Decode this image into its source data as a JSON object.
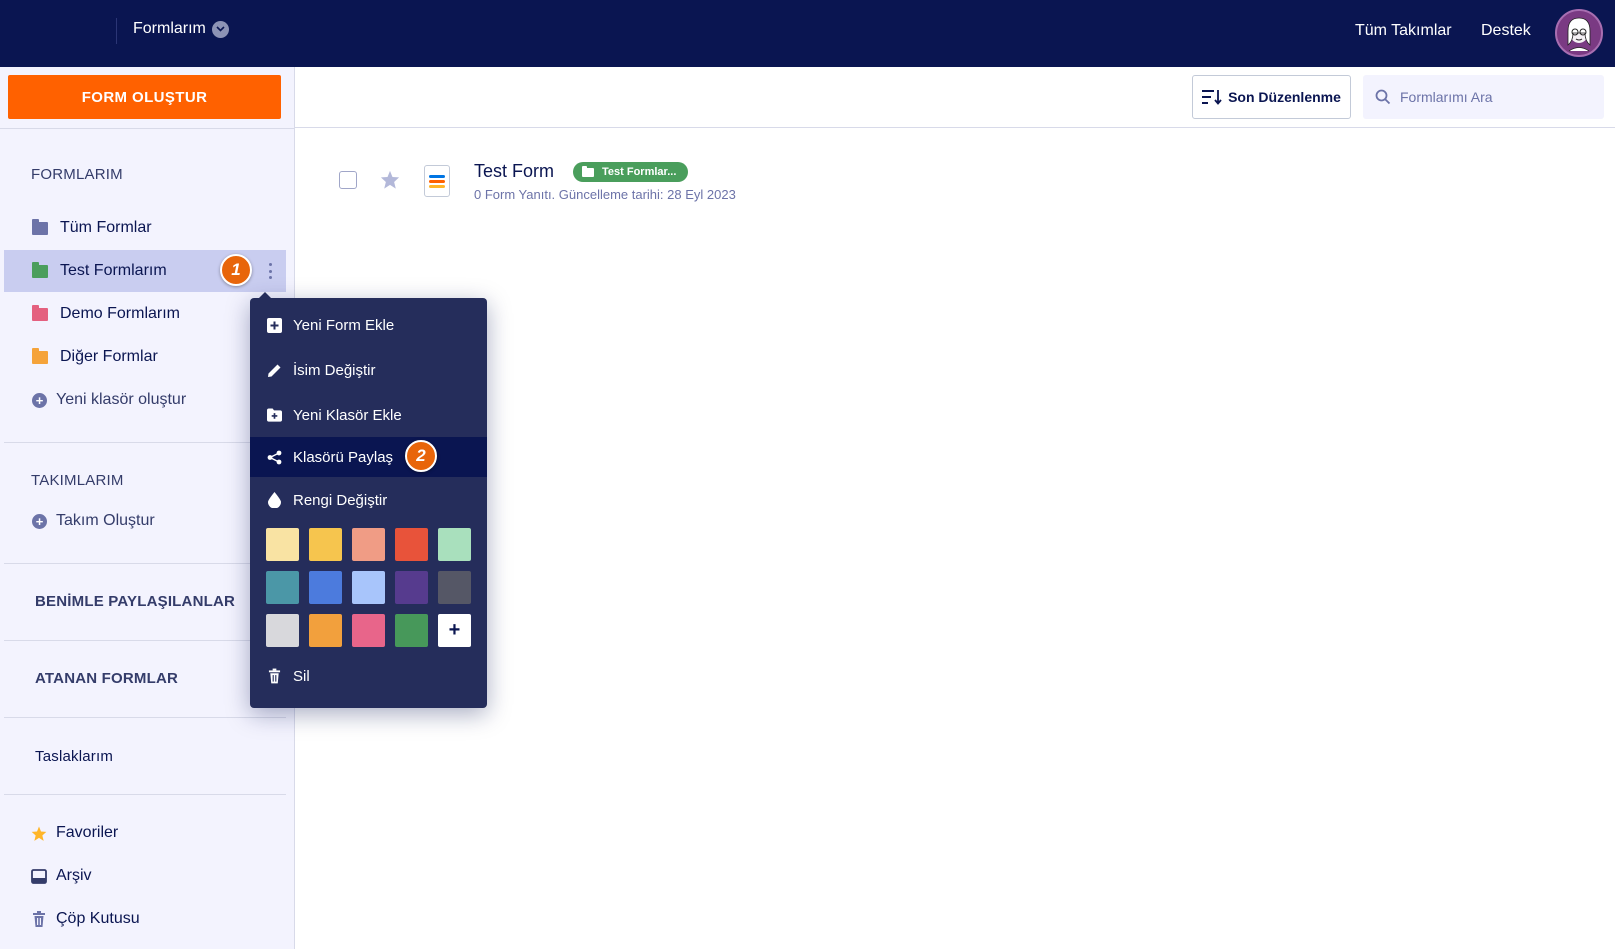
{
  "header": {
    "forms_menu_label": "Formlarım",
    "nav": [
      "Tüm Takımlar",
      "Destek"
    ]
  },
  "sidebar": {
    "create_button": "FORM OLUŞTUR",
    "my_forms_heading": "FORMLARIM",
    "folders": [
      {
        "label": "Tüm Formlar",
        "color": "#6c73a8"
      },
      {
        "label": "Test Formlarım",
        "color": "#4a9e5c"
      },
      {
        "label": "Demo Formlarım",
        "color": "#e4607f"
      },
      {
        "label": "Diğer Formlar",
        "color": "#f5a33a"
      }
    ],
    "new_folder": "Yeni klasör oluştur",
    "teams_heading": "TAKIMLARIM",
    "create_team": "Takım Oluştur",
    "shared_heading": "BENİMLE PAYLAŞILANLAR",
    "assigned_heading": "ATANAN FORMLAR",
    "drafts": "Taslaklarım",
    "favorites": "Favoriler",
    "archive": "Arşiv",
    "trash": "Çöp Kutusu"
  },
  "toolbar": {
    "sort_label": "Son Düzenlenme",
    "search_placeholder": "Formlarımı Ara"
  },
  "forms": [
    {
      "title": "Test Form",
      "folder_tag": "Test Formlar...",
      "meta": "0 Form Yanıtı. Güncelleme tarihi: 28 Eyl 2023"
    }
  ],
  "context_menu": {
    "items": [
      "Yeni Form Ekle",
      "İsim Değiştir",
      "Yeni Klasör Ekle",
      "Klasörü Paylaş",
      "Rengi Değiştir"
    ],
    "delete": "Sil",
    "colors": [
      "#f9e3a3",
      "#f6c54e",
      "#f09c85",
      "#e8533a",
      "#a9e0bd",
      "#4b97a7",
      "#4c7bdd",
      "#a8c5fb",
      "#563b8e",
      "#555766",
      "#d8d8dc",
      "#f2a03d",
      "#e8658a",
      "#47985a"
    ],
    "add_color": "+"
  },
  "annotations": [
    "1",
    "2"
  ],
  "colors": {
    "topbar": "#0a1551",
    "accent": "#ff6100",
    "menu_bg": "#252d5b",
    "badge": "#e8650a"
  }
}
